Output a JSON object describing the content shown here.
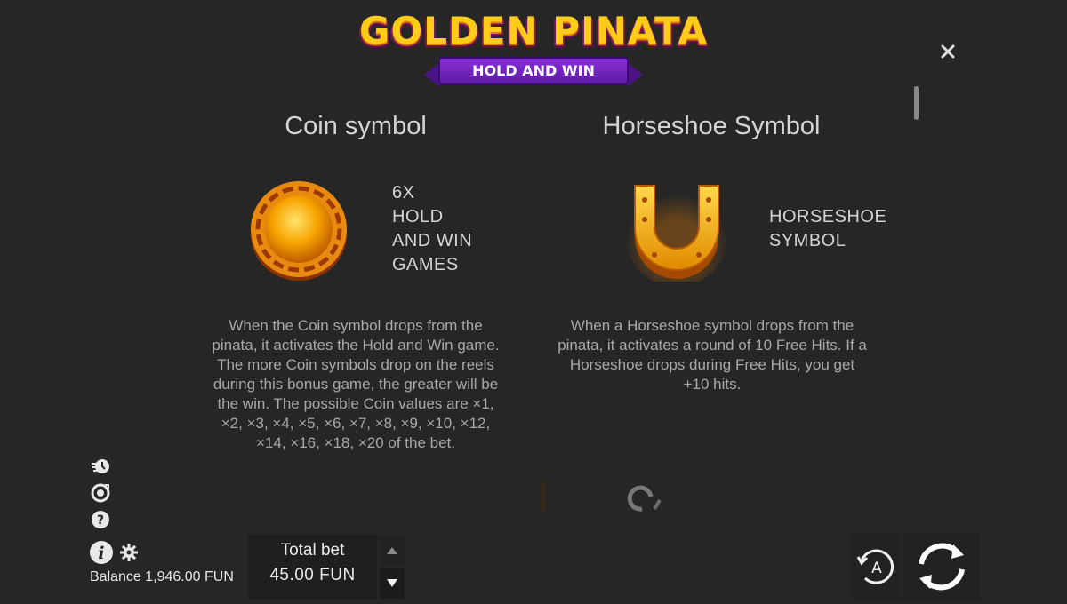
{
  "logo": {
    "title": "GOLDEN PINATA",
    "subtitle": "HOLD AND WIN"
  },
  "coin": {
    "title": "Coin symbol",
    "lines": [
      "6X",
      "HOLD",
      "AND WIN",
      "GAMES"
    ],
    "description": "When the Coin symbol drops from the pinata, it activates the Hold and Win game. The more Coin symbols drop on the reels during this bonus game, the greater will be the win. The possible Coin values are ×1, ×2, ×3, ×4, ×5, ×6, ×7, ×8, ×9, ×10, ×12, ×14, ×16, ×18, ×20 of the bet."
  },
  "horseshoe": {
    "title": "Horseshoe Symbol",
    "lines": [
      "HORSESHOE",
      "SYMBOL"
    ],
    "description": "When a Horseshoe symbol drops from the pinata, it activates a round of 10 Free Hits. If a Horseshoe drops during Free Hits, you get +10 hits."
  },
  "footer": {
    "balance": "Balance 1,946.00 FUN",
    "bet_label": "Total bet",
    "bet_value": "45.00 FUN"
  },
  "icons": {
    "close": "close-icon",
    "side": [
      "turbo-icon",
      "history-icon",
      "help-icon"
    ],
    "info": "info-icon",
    "settings": "gear-icon",
    "autoplay": "autoplay-icon",
    "spin": "spin-icon"
  },
  "colors": {
    "background": "#262626",
    "gold": "#ffcc1a",
    "ribbon": "#6a23bd"
  }
}
